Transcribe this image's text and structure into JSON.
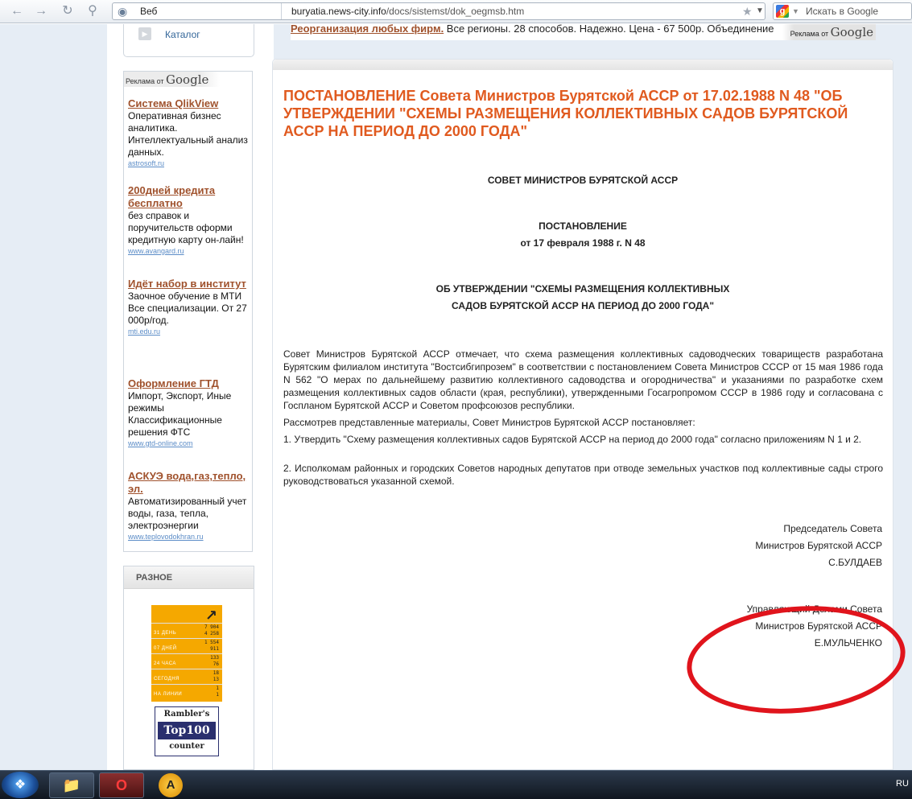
{
  "browser": {
    "web_button": "Веб",
    "url_domain": "buryatia.news-city.info",
    "url_path": "/docs/sistemst/dok_oegmsb.htm",
    "search_placeholder": "Искать в Google"
  },
  "sidebar": {
    "catalog": "Каталог",
    "ads_by": "Реклама от",
    "google": "Google",
    "ads": [
      {
        "title": "Система QlikView",
        "text": "Оперативная бизнес аналитика. Интеллектуальный анализ данных.",
        "url": "astrosoft.ru"
      },
      {
        "title": "200дней кредита бесплатно",
        "text": "без справок и поручительств оформи кредитную карту он-лайн!",
        "url": "www.avangard.ru"
      },
      {
        "title": "Идёт набор в институт",
        "text": "Заочное обучение в МТИ Все специализации. От 27 000р/год.",
        "url": "mti.edu.ru"
      },
      {
        "title": "Оформление ГТД",
        "text": "Импорт, Экспорт, Иные режимы Классификационные решения ФТС",
        "url": "www.gtd-online.com"
      },
      {
        "title": "АСКУЭ вода,газ,тепло, эл.",
        "text": "Автоматизированный учет воды, газа, тепла, электроэнергии",
        "url": "www.teplovodokhran.ru"
      }
    ],
    "raznoe": "РАЗНОЕ",
    "counter": {
      "rows": [
        {
          "label": "31 ДЕНЬ",
          "v1": "7 904",
          "v2": "4 258"
        },
        {
          "label": "07 ДНЕЙ",
          "v1": "1 554",
          "v2": "911"
        },
        {
          "label": "24 ЧАСА",
          "v1": "133",
          "v2": "76"
        },
        {
          "label": "СЕГОДНЯ",
          "v1": "18",
          "v2": "13"
        },
        {
          "label": "НА ЛИНИИ",
          "v1": "1",
          "v2": "1"
        }
      ]
    },
    "rambler": {
      "line1": "Rambler's",
      "line2": "Top100",
      "line3": "counter"
    }
  },
  "top_ad": {
    "link": "Реорганизация любых фирм.",
    "text": " Все регионы. 28 способов. Надежно. Цена - 67 500р. Объединение",
    "ads_by": "Реклама от",
    "google": "Google"
  },
  "document": {
    "title": "ПОСТАНОВЛЕНИЕ Совета Министров Бурятской АССР от 17.02.1988 N 48 \"ОБ УТВЕРЖДЕНИИ \"СХЕМЫ РАЗМЕЩЕНИЯ КОЛЛЕКТИВНЫХ САДОВ БУРЯТСКОЙ АССР НА ПЕРИОД ДО 2000 ГОДА\"",
    "issuer": "СОВЕТ МИНИСТРОВ БУРЯТСКОЙ АССР",
    "doc_type": "ПОСТАНОВЛЕНИЕ",
    "doc_date": "от 17 февраля 1988 г. N 48",
    "subject_line1": "ОБ УТВЕРЖДЕНИИ \"СХЕМЫ РАЗМЕЩЕНИЯ КОЛЛЕКТИВНЫХ",
    "subject_line2": "САДОВ БУРЯТСКОЙ АССР НА ПЕРИОД ДО 2000 ГОДА\"",
    "paragraphs": [
      "Совет Министров Бурятской АССР отмечает, что схема размещения коллективных садоводческих товариществ разработана Бурятским филиалом института \"Востсибгипрозем\" в соответствии с постановлением Совета Министров СССР от 15 мая 1986 года N 562 \"О мерах по дальнейшему развитию коллективного садоводства и огородничества\" и указаниями по разработке схем размещения коллективных садов области (края, республики), утвержденными Госагропромом СССР в 1986 году и согласована с Госпланом Бурятской АССР и Советом профсоюзов республики.",
      "Рассмотрев представленные материалы, Совет Министров Бурятской АССР постановляет:",
      "1. Утвердить \"Схему размещения коллективных садов Бурятской АССР на период до 2000 года\" согласно приложениям N 1 и 2.",
      "2. Исполкомам районных и городских Советов народных депутатов при отводе земельных участков под коллективные сады строго руководствоваться указанной схемой."
    ],
    "signature1": {
      "line1": "Председатель Совета",
      "line2": "Министров Бурятской АССР",
      "line3": "С.БУЛДАЕВ"
    },
    "signature2": {
      "line1": "Управляющий Делами Совета",
      "line2": "Министров Бурятской АССР",
      "line3": "Е.МУЛЬЧЕНКО"
    }
  },
  "taskbar": {
    "lang": "RU"
  }
}
